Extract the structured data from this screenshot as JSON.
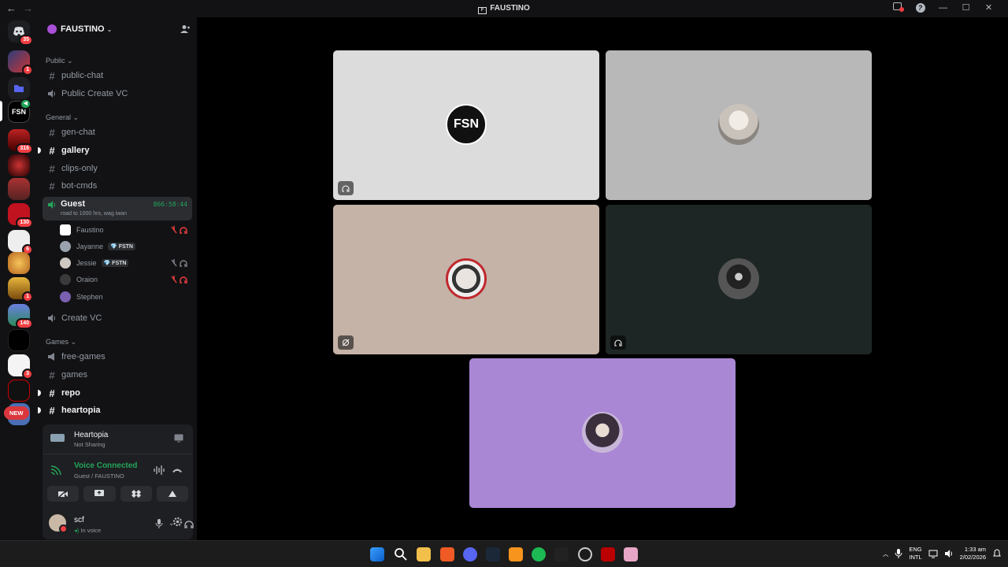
{
  "titlebar": {
    "title": "FAUSTINO",
    "back_icon": "←",
    "forward_icon": "→",
    "minimize": "—",
    "maximize": "☐",
    "close": "✕"
  },
  "rail": {
    "dm_badge": "35",
    "servers": [
      {
        "badge": "1"
      },
      {
        "badge": ""
      },
      {
        "badge": ""
      },
      {
        "badge": "316"
      },
      {
        "badge": ""
      },
      {
        "badge": ""
      },
      {
        "badge": "130"
      },
      {
        "badge": "6"
      },
      {
        "badge": ""
      },
      {
        "badge": "1"
      },
      {
        "badge": "140"
      },
      {
        "badge": ""
      },
      {
        "badge": "3"
      },
      {
        "badge": ""
      }
    ],
    "new_label": "NEW"
  },
  "guild": {
    "name": "FAUSTINO",
    "chevron": "⌄"
  },
  "categories": {
    "public": "Public ⌄",
    "general": "General ⌄",
    "games": "Games ⌄"
  },
  "channels": {
    "public_chat": "public-chat",
    "public_create_vc": "Public Create VC",
    "gen_chat": "gen-chat",
    "gallery": "gallery",
    "clips_only": "clips-only",
    "bot_cmds": "bot-cmds",
    "guest": "Guest",
    "guest_status": "road to 1000 hrs, wag iwan",
    "guest_timer": "866:58:44",
    "create_vc": "Create VC",
    "free_games": "free-games",
    "games": "games",
    "repo": "repo",
    "heartopia": "heartopia"
  },
  "members": [
    {
      "name": "Faustino",
      "tag": ""
    },
    {
      "name": "Jayanne",
      "tag": "💎 FSTN"
    },
    {
      "name": "Jessie",
      "tag": "💎 FSTN"
    },
    {
      "name": "Oraion",
      "tag": ""
    },
    {
      "name": "Stephen",
      "tag": ""
    }
  ],
  "activity": {
    "title": "Heartopia",
    "sub": "Not Sharing"
  },
  "voice": {
    "status": "Voice Connected",
    "location": "Guest / FAUSTINO"
  },
  "user": {
    "name": "scf",
    "status": "In voice"
  },
  "taskbar": {
    "lang1": "ENG",
    "lang2": "INTL",
    "time": "1:33 am",
    "date": "2/02/2026"
  },
  "colors": {
    "tile1": "#dcdcdc",
    "tile2": "#b8b8b8",
    "tile3": "#c5b3a8",
    "tile4": "#1d2624",
    "tile5": "#a987d4",
    "accent_green": "#23a55a",
    "badge_red": "#f23f43"
  }
}
